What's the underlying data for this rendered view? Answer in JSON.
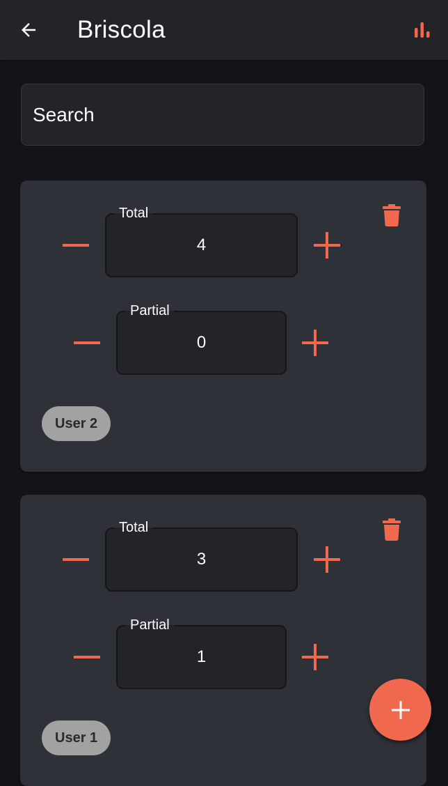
{
  "appbar": {
    "title": "Briscola",
    "back_icon": "arrow-back-icon",
    "stats_icon": "bar-chart-icon"
  },
  "search": {
    "placeholder": "Search",
    "value": ""
  },
  "colors": {
    "accent": "#f0694f",
    "background": "#131417",
    "surface": "#2e3137",
    "field": "#222428",
    "chip": "#a2a2a2"
  },
  "players": [
    {
      "user": "User 2",
      "total_label": "Total",
      "total": "4",
      "partial_label": "Partial",
      "partial": "0"
    },
    {
      "user": "User 1",
      "total_label": "Total",
      "total": "3",
      "partial_label": "Partial",
      "partial": "1"
    }
  ],
  "fab": {
    "icon": "plus-icon"
  }
}
